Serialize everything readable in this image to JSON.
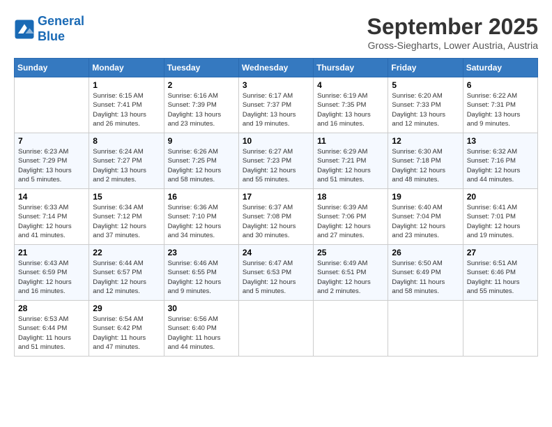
{
  "header": {
    "logo_line1": "General",
    "logo_line2": "Blue",
    "month": "September 2025",
    "location": "Gross-Siegharts, Lower Austria, Austria"
  },
  "weekdays": [
    "Sunday",
    "Monday",
    "Tuesday",
    "Wednesday",
    "Thursday",
    "Friday",
    "Saturday"
  ],
  "weeks": [
    [
      {
        "day": "",
        "info": ""
      },
      {
        "day": "1",
        "info": "Sunrise: 6:15 AM\nSunset: 7:41 PM\nDaylight: 13 hours\nand 26 minutes."
      },
      {
        "day": "2",
        "info": "Sunrise: 6:16 AM\nSunset: 7:39 PM\nDaylight: 13 hours\nand 23 minutes."
      },
      {
        "day": "3",
        "info": "Sunrise: 6:17 AM\nSunset: 7:37 PM\nDaylight: 13 hours\nand 19 minutes."
      },
      {
        "day": "4",
        "info": "Sunrise: 6:19 AM\nSunset: 7:35 PM\nDaylight: 13 hours\nand 16 minutes."
      },
      {
        "day": "5",
        "info": "Sunrise: 6:20 AM\nSunset: 7:33 PM\nDaylight: 13 hours\nand 12 minutes."
      },
      {
        "day": "6",
        "info": "Sunrise: 6:22 AM\nSunset: 7:31 PM\nDaylight: 13 hours\nand 9 minutes."
      }
    ],
    [
      {
        "day": "7",
        "info": "Sunrise: 6:23 AM\nSunset: 7:29 PM\nDaylight: 13 hours\nand 5 minutes."
      },
      {
        "day": "8",
        "info": "Sunrise: 6:24 AM\nSunset: 7:27 PM\nDaylight: 13 hours\nand 2 minutes."
      },
      {
        "day": "9",
        "info": "Sunrise: 6:26 AM\nSunset: 7:25 PM\nDaylight: 12 hours\nand 58 minutes."
      },
      {
        "day": "10",
        "info": "Sunrise: 6:27 AM\nSunset: 7:23 PM\nDaylight: 12 hours\nand 55 minutes."
      },
      {
        "day": "11",
        "info": "Sunrise: 6:29 AM\nSunset: 7:21 PM\nDaylight: 12 hours\nand 51 minutes."
      },
      {
        "day": "12",
        "info": "Sunrise: 6:30 AM\nSunset: 7:18 PM\nDaylight: 12 hours\nand 48 minutes."
      },
      {
        "day": "13",
        "info": "Sunrise: 6:32 AM\nSunset: 7:16 PM\nDaylight: 12 hours\nand 44 minutes."
      }
    ],
    [
      {
        "day": "14",
        "info": "Sunrise: 6:33 AM\nSunset: 7:14 PM\nDaylight: 12 hours\nand 41 minutes."
      },
      {
        "day": "15",
        "info": "Sunrise: 6:34 AM\nSunset: 7:12 PM\nDaylight: 12 hours\nand 37 minutes."
      },
      {
        "day": "16",
        "info": "Sunrise: 6:36 AM\nSunset: 7:10 PM\nDaylight: 12 hours\nand 34 minutes."
      },
      {
        "day": "17",
        "info": "Sunrise: 6:37 AM\nSunset: 7:08 PM\nDaylight: 12 hours\nand 30 minutes."
      },
      {
        "day": "18",
        "info": "Sunrise: 6:39 AM\nSunset: 7:06 PM\nDaylight: 12 hours\nand 27 minutes."
      },
      {
        "day": "19",
        "info": "Sunrise: 6:40 AM\nSunset: 7:04 PM\nDaylight: 12 hours\nand 23 minutes."
      },
      {
        "day": "20",
        "info": "Sunrise: 6:41 AM\nSunset: 7:01 PM\nDaylight: 12 hours\nand 19 minutes."
      }
    ],
    [
      {
        "day": "21",
        "info": "Sunrise: 6:43 AM\nSunset: 6:59 PM\nDaylight: 12 hours\nand 16 minutes."
      },
      {
        "day": "22",
        "info": "Sunrise: 6:44 AM\nSunset: 6:57 PM\nDaylight: 12 hours\nand 12 minutes."
      },
      {
        "day": "23",
        "info": "Sunrise: 6:46 AM\nSunset: 6:55 PM\nDaylight: 12 hours\nand 9 minutes."
      },
      {
        "day": "24",
        "info": "Sunrise: 6:47 AM\nSunset: 6:53 PM\nDaylight: 12 hours\nand 5 minutes."
      },
      {
        "day": "25",
        "info": "Sunrise: 6:49 AM\nSunset: 6:51 PM\nDaylight: 12 hours\nand 2 minutes."
      },
      {
        "day": "26",
        "info": "Sunrise: 6:50 AM\nSunset: 6:49 PM\nDaylight: 11 hours\nand 58 minutes."
      },
      {
        "day": "27",
        "info": "Sunrise: 6:51 AM\nSunset: 6:46 PM\nDaylight: 11 hours\nand 55 minutes."
      }
    ],
    [
      {
        "day": "28",
        "info": "Sunrise: 6:53 AM\nSunset: 6:44 PM\nDaylight: 11 hours\nand 51 minutes."
      },
      {
        "day": "29",
        "info": "Sunrise: 6:54 AM\nSunset: 6:42 PM\nDaylight: 11 hours\nand 47 minutes."
      },
      {
        "day": "30",
        "info": "Sunrise: 6:56 AM\nSunset: 6:40 PM\nDaylight: 11 hours\nand 44 minutes."
      },
      {
        "day": "",
        "info": ""
      },
      {
        "day": "",
        "info": ""
      },
      {
        "day": "",
        "info": ""
      },
      {
        "day": "",
        "info": ""
      }
    ]
  ]
}
